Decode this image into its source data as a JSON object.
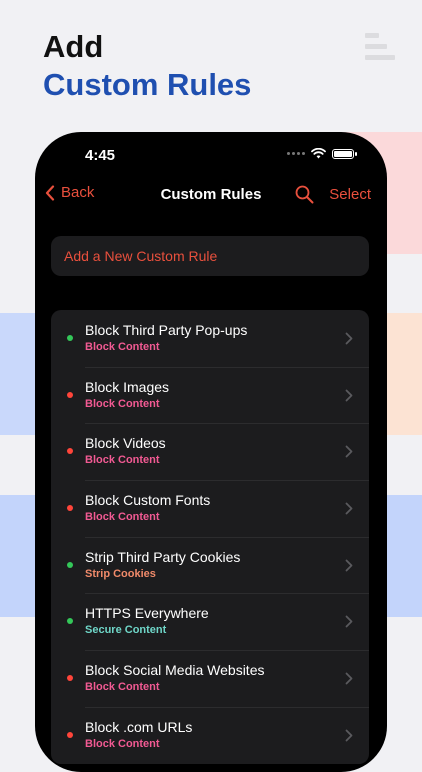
{
  "headline": {
    "line1": "Add",
    "line2": "Custom Rules"
  },
  "status_bar": {
    "time": "4:45"
  },
  "nav": {
    "back_label": "Back",
    "title": "Custom Rules",
    "select_label": "Select"
  },
  "add_rule_label": "Add a New Custom Rule",
  "colors": {
    "accent": "#e9503d",
    "green": "#34c759",
    "red": "#ff453a",
    "pink": "#f25a93",
    "orange": "#f08a6a",
    "teal": "#6fd6c8"
  },
  "rules": [
    {
      "title": "Block Third Party Pop-ups",
      "category": "Block Content",
      "status": "green"
    },
    {
      "title": "Block Images",
      "category": "Block Content",
      "status": "red"
    },
    {
      "title": "Block Videos",
      "category": "Block Content",
      "status": "red"
    },
    {
      "title": "Block Custom Fonts",
      "category": "Block Content",
      "status": "red"
    },
    {
      "title": "Strip Third Party Cookies",
      "category": "Strip Cookies",
      "status": "green"
    },
    {
      "title": "HTTPS Everywhere",
      "category": "Secure Content",
      "status": "green"
    },
    {
      "title": "Block Social Media Websites",
      "category": "Block Content",
      "status": "red"
    },
    {
      "title": "Block .com URLs",
      "category": "Block Content",
      "status": "red"
    }
  ]
}
